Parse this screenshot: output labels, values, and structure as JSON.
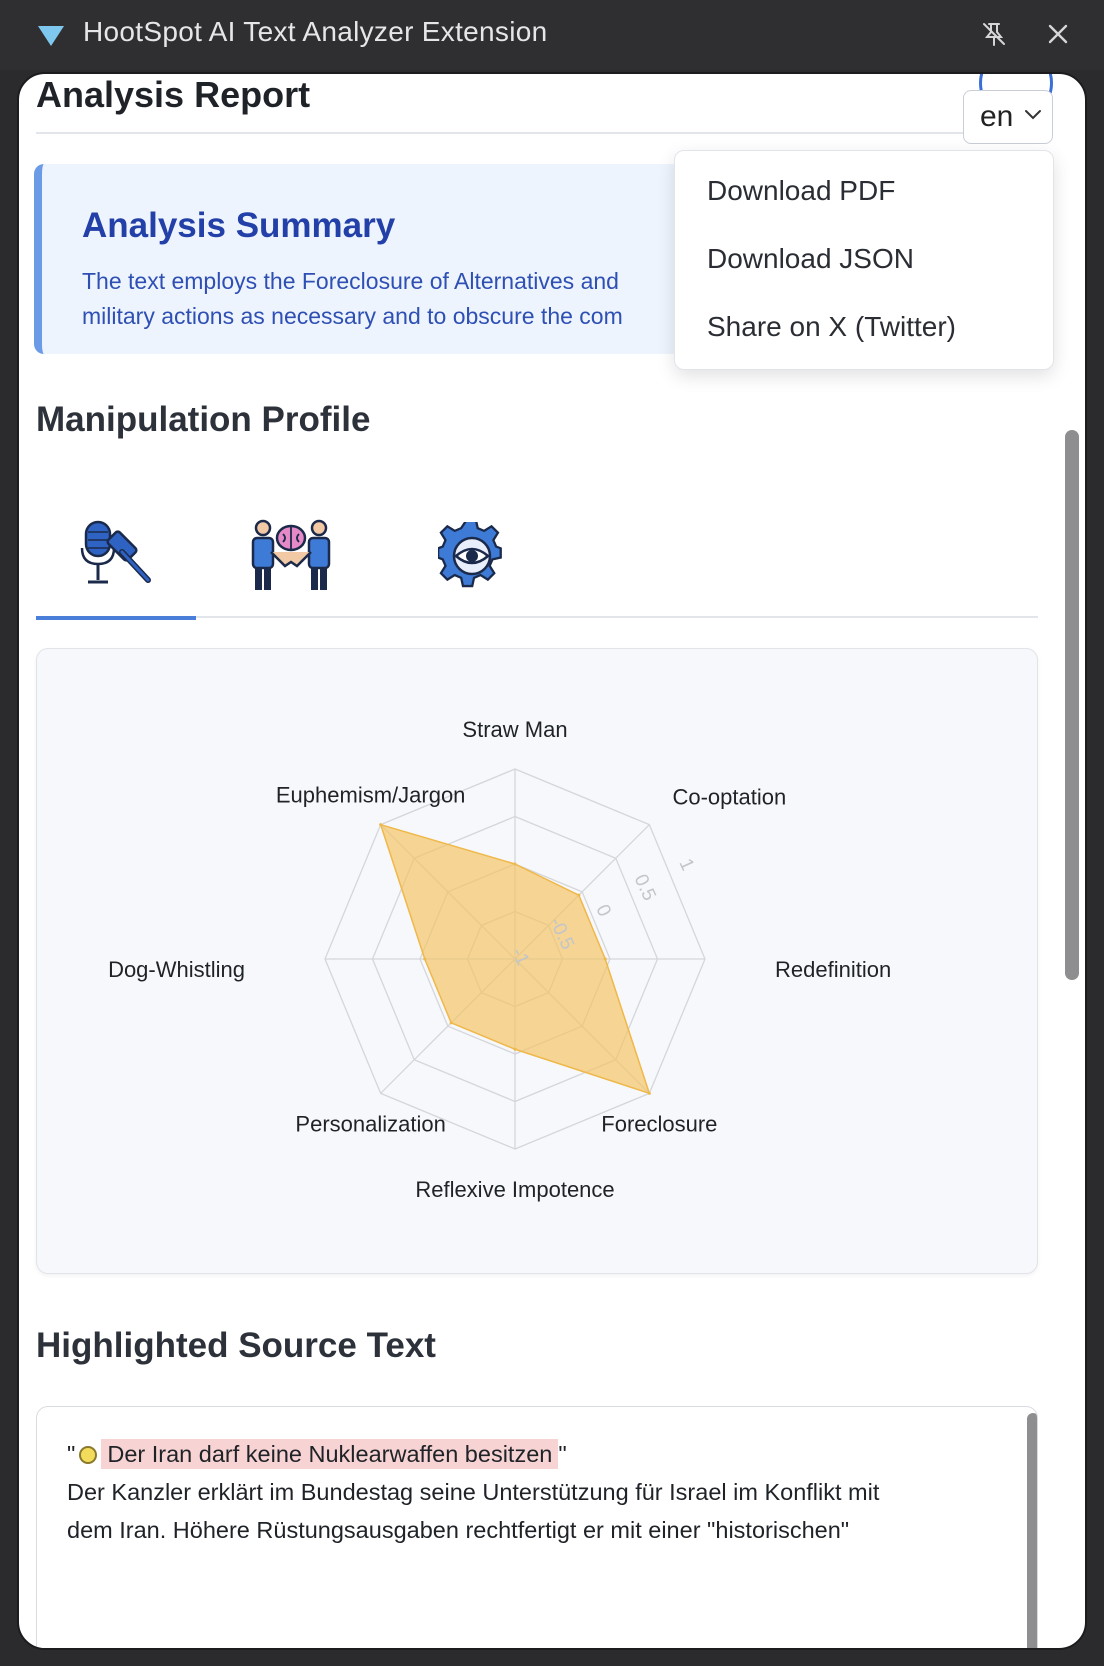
{
  "window": {
    "title": "HootSpot AI Text Analyzer Extension"
  },
  "header": {
    "title": "Analysis Report",
    "language": "en"
  },
  "menu": {
    "items": [
      "Download PDF",
      "Download JSON",
      "Share on X (Twitter)"
    ]
  },
  "summary": {
    "title": "Analysis Summary",
    "line1": "The text employs the Foreclosure of Alternatives and",
    "line2": "military actions as necessary and to obscure the com"
  },
  "profile": {
    "title": "Manipulation Profile"
  },
  "tabs": [
    {
      "icon": "gavel-microphone-icon",
      "active": true
    },
    {
      "icon": "handshake-brain-icon",
      "active": false
    },
    {
      "icon": "gear-eye-icon",
      "active": false
    }
  ],
  "chart_data": {
    "type": "radar",
    "categories": [
      "Straw Man",
      "Co-optation",
      "Redefinition",
      "Foreclosure",
      "Reflexive Impotence",
      "Personalization",
      "Dog-Whistling",
      "Euphemism/Jargon"
    ],
    "values": [
      0.0,
      -0.05,
      -0.05,
      1.0,
      -0.05,
      -0.05,
      -0.05,
      1.0
    ],
    "rlim": [
      -1,
      1
    ],
    "tick_labels": [
      "-1",
      "-0.5",
      "0",
      "0.5",
      "1"
    ],
    "fill_color": "#f3c568",
    "grid": true
  },
  "source": {
    "title": "Highlighted Source Text",
    "quote_open": "\"",
    "highlight": "Der Iran darf keine Nuklearwaffen besitzen",
    "quote_close": "\"",
    "line2": "Der Kanzler erklärt im Bundestag seine Unterstützung für Israel im Konflikt mit",
    "line3": "dem Iran. Höhere Rüstungsausgaben rechtfertigt er mit einer \"historischen\""
  }
}
